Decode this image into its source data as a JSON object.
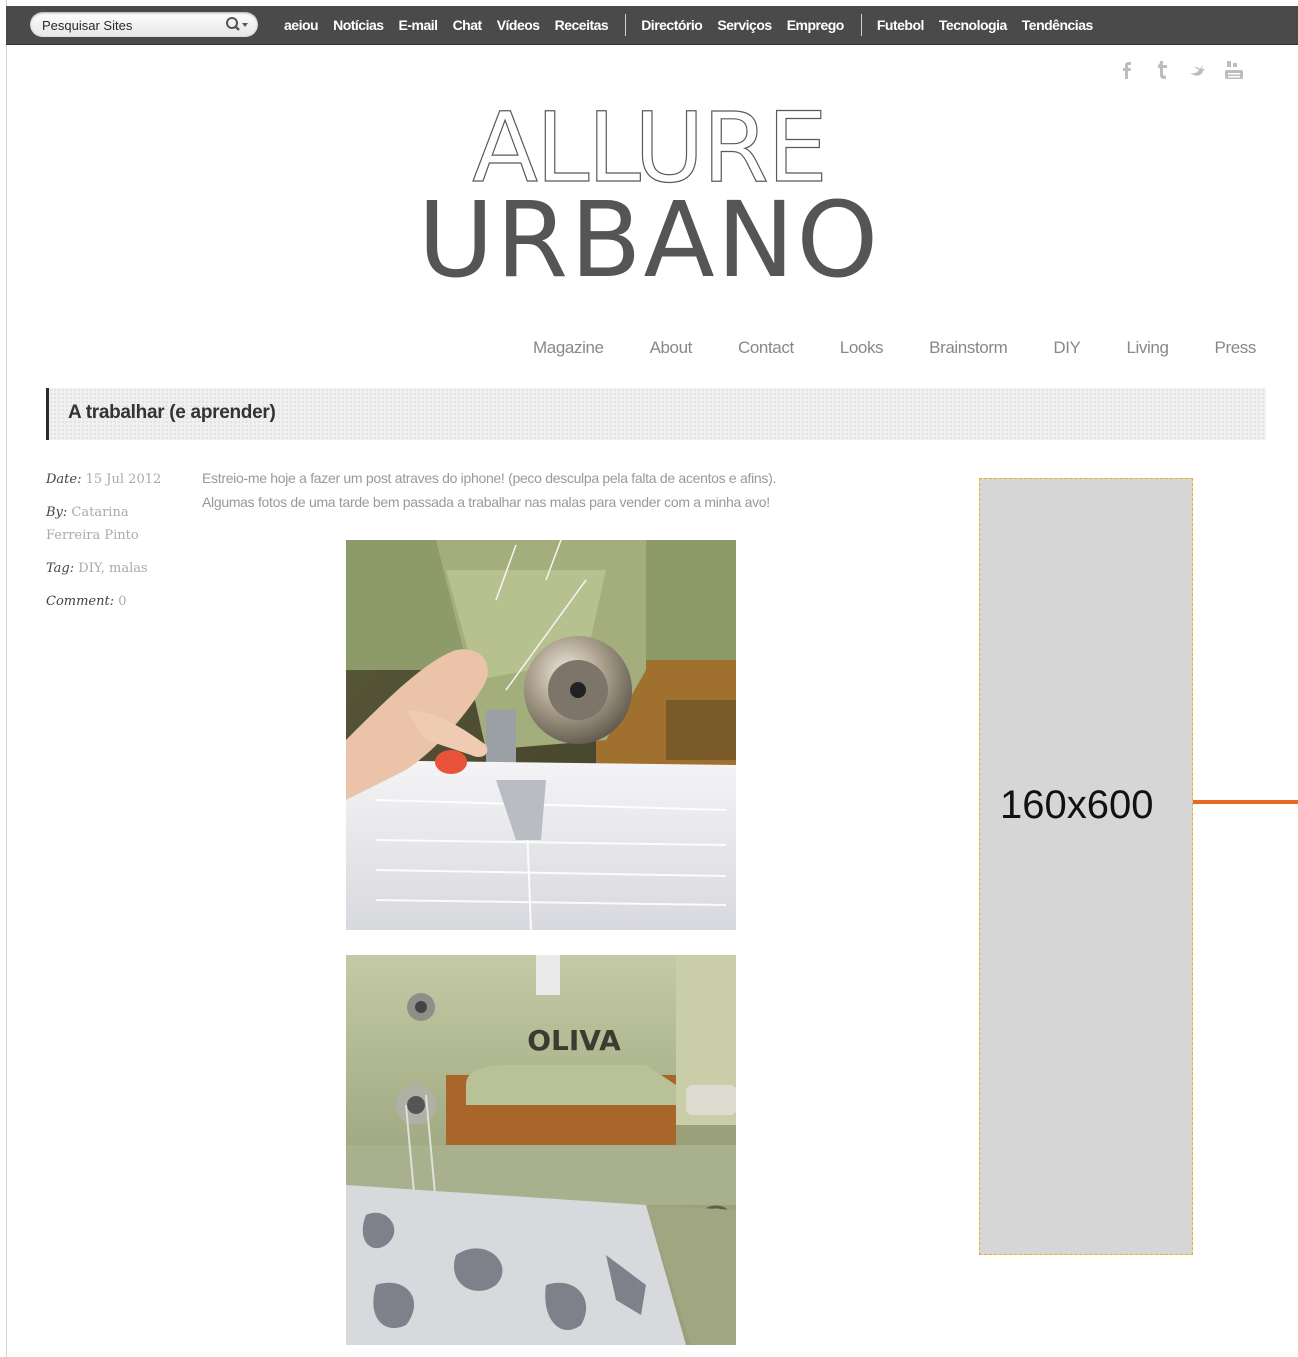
{
  "topbar": {
    "search_placeholder": "Pesquisar Sites",
    "group1": [
      "aeiou",
      "Notícias",
      "E-mail",
      "Chat",
      "Vídeos",
      "Receitas"
    ],
    "group2": [
      "Directório",
      "Serviços",
      "Emprego"
    ],
    "group3": [
      "Futebol",
      "Tecnologia",
      "Tendências"
    ]
  },
  "social": [
    "facebook-icon",
    "tumblr-icon",
    "twitter-icon",
    "youtube-icon"
  ],
  "logo": {
    "line1": "ALLURE",
    "line2": "URBANO"
  },
  "mainnav": [
    "Magazine",
    "About",
    "Contact",
    "Looks",
    "Brainstorm",
    "DIY",
    "Living",
    "Press"
  ],
  "post": {
    "title": "A trabalhar (e aprender)",
    "date_label": "Date:",
    "date": "15 Jul 2012",
    "by_label": "By:",
    "author": "Catarina Ferreira Pinto",
    "tag_label": "Tag:",
    "tags": "DIY, malas",
    "comment_label": "Comment:",
    "comments": "0",
    "body_line1": "Estreio-me hoje a fazer um post atraves do iphone! (peco desculpa pela falta de acentos e afins).",
    "body_line2": "Algumas fotos de uma tarde bem passada a trabalhar nas malas para vender com a minha avo!",
    "photo2_text": "OLIVA"
  },
  "ad": {
    "label": "160x600"
  },
  "colors": {
    "topbar": "#4a4a4a",
    "accent_arrow": "#e86a1f",
    "ad_bg": "#d6d6d6"
  }
}
